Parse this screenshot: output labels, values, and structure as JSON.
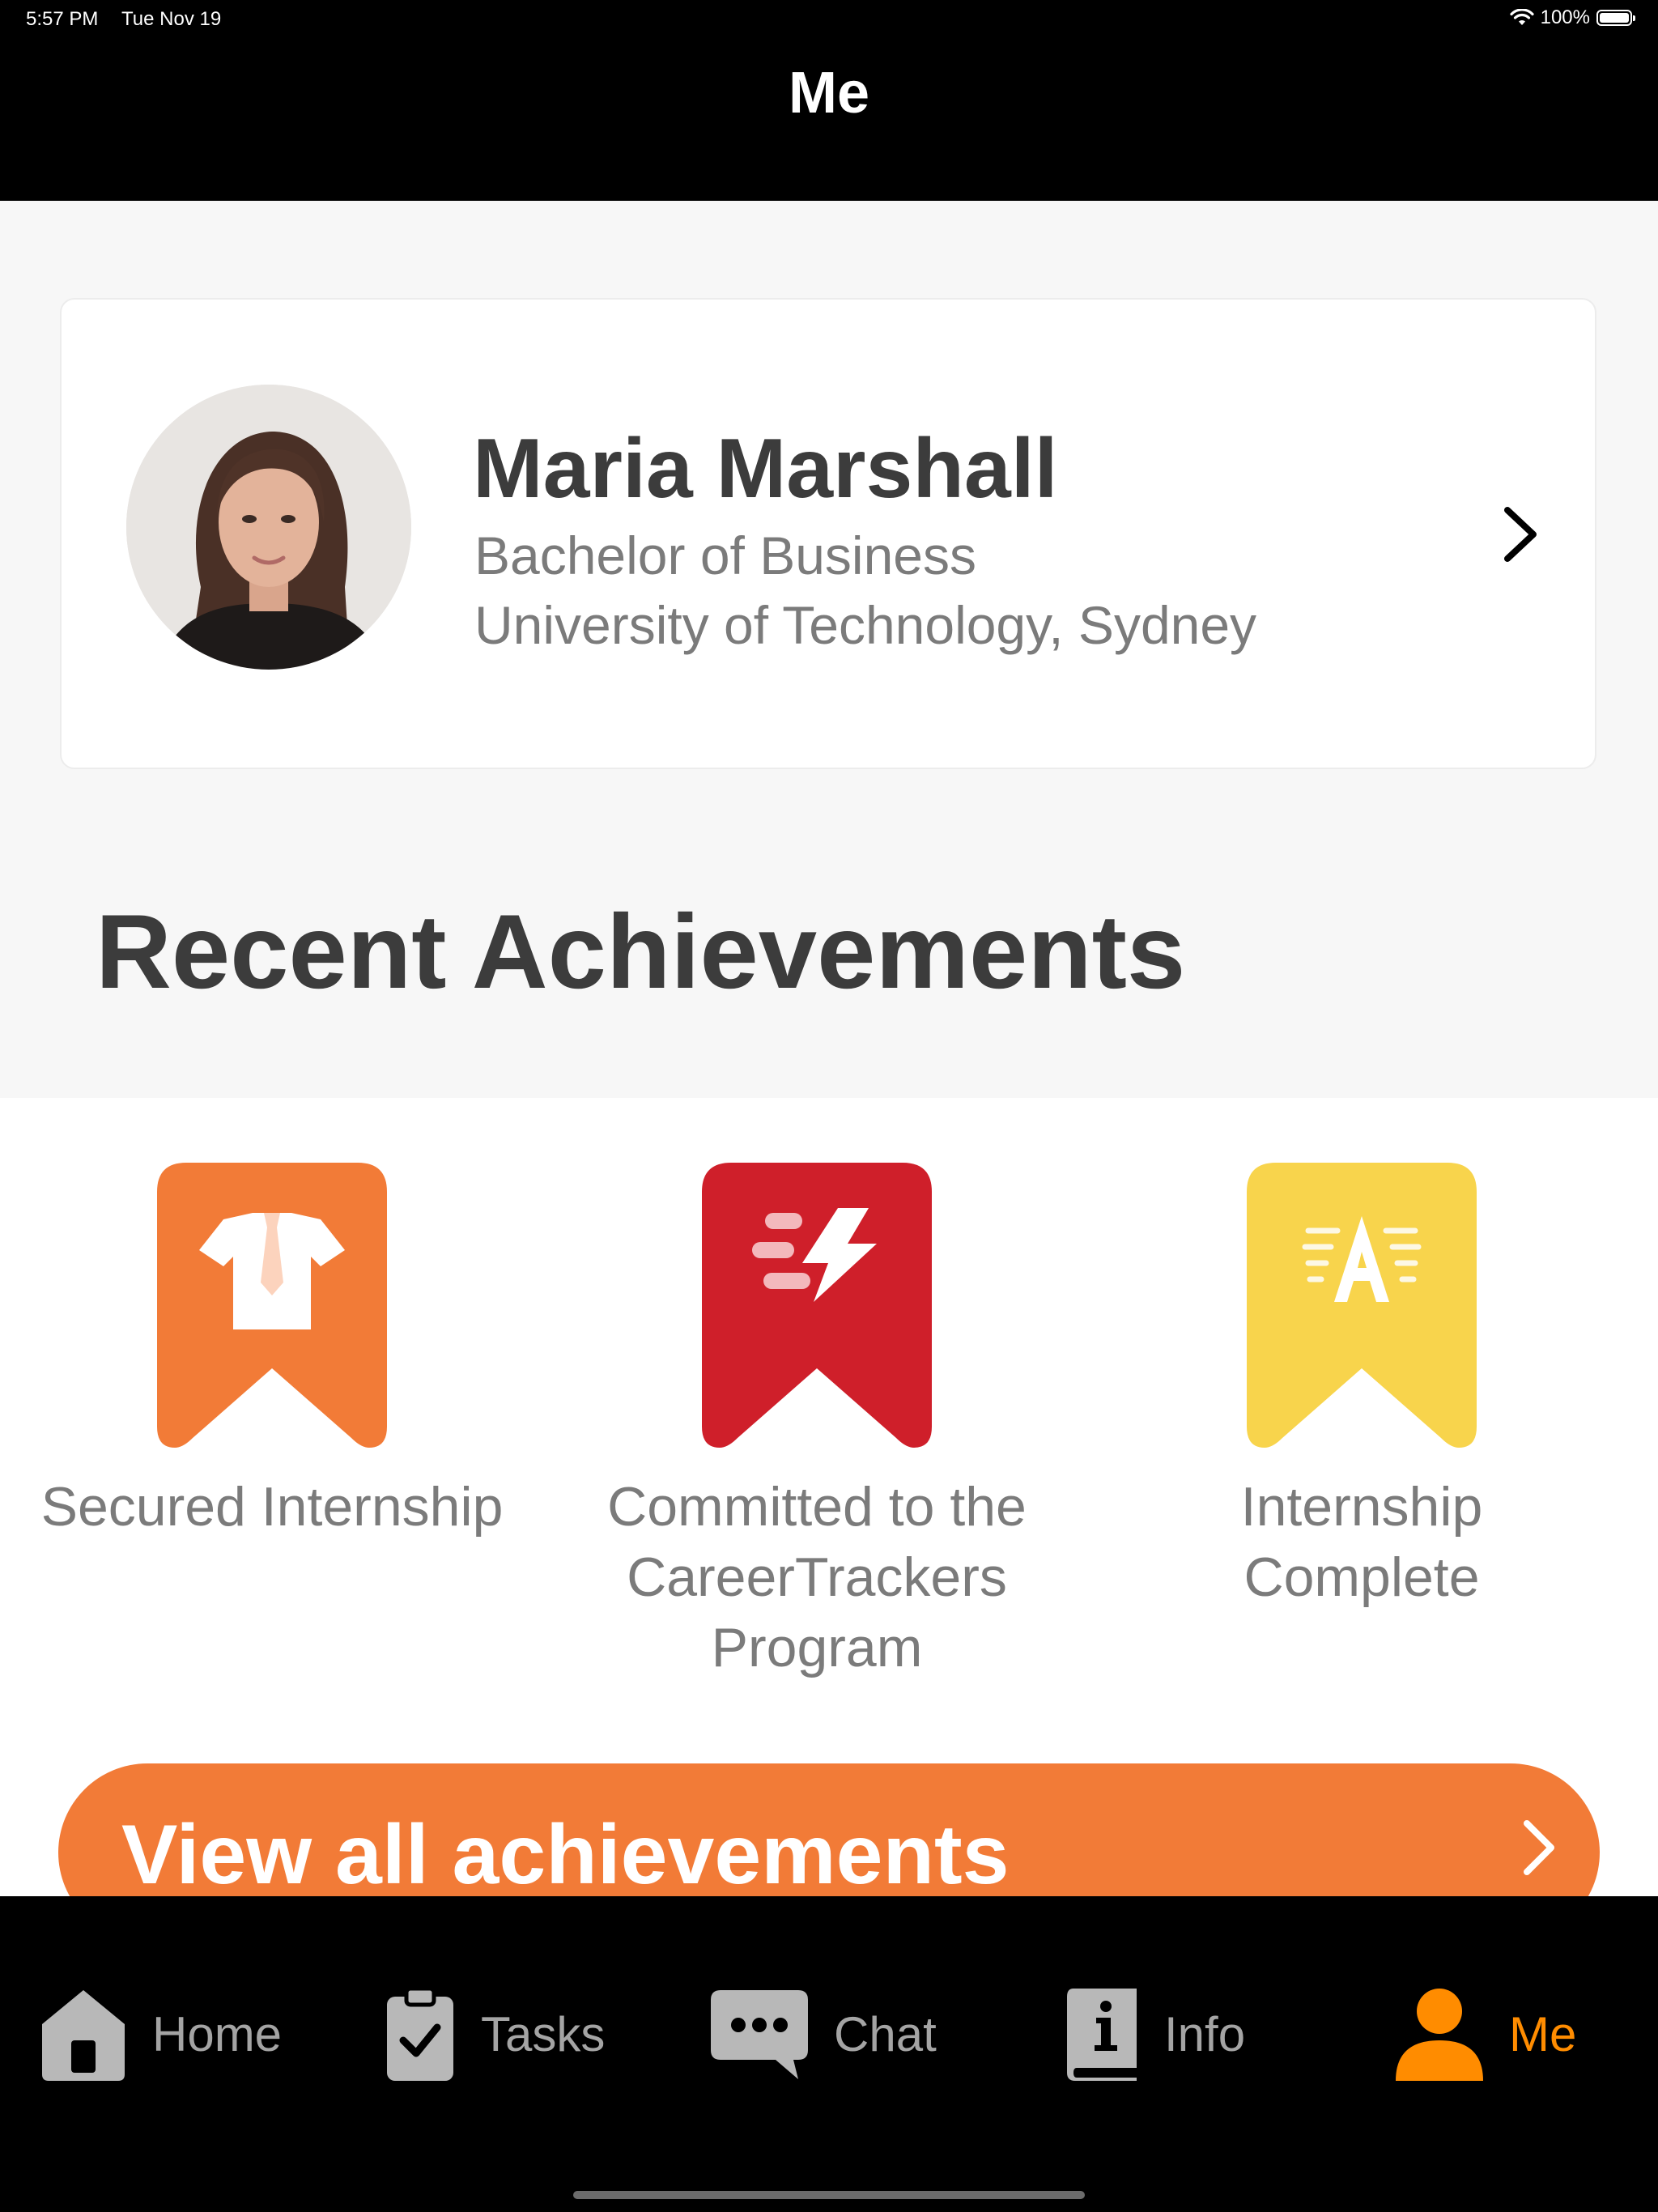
{
  "status_bar": {
    "time": "5:57 PM",
    "date": "Tue Nov 19",
    "battery": "100%"
  },
  "header": {
    "title": "Me"
  },
  "profile": {
    "name": "Maria Marshall",
    "degree": "Bachelor of Business",
    "university": "University of Technology, Sydney"
  },
  "achievements": {
    "title": "Recent Achievements",
    "items": [
      {
        "label": "Secured Internship",
        "color": "#f27b37",
        "icon": "shirt-tie-icon"
      },
      {
        "label": "Committed to the CareerTrackers Program",
        "color": "#cf1f2a",
        "icon": "lightning-icon"
      },
      {
        "label": "Internship Complete",
        "color": "#f8d44c",
        "icon": "letter-a-icon"
      }
    ],
    "view_all_label": "View all achievements"
  },
  "tabbar": {
    "tabs": [
      {
        "label": "Home",
        "icon": "home-icon",
        "active": false
      },
      {
        "label": "Tasks",
        "icon": "clipboard-icon",
        "active": false
      },
      {
        "label": "Chat",
        "icon": "chat-bubble-icon",
        "active": false
      },
      {
        "label": "Info",
        "icon": "info-book-icon",
        "active": false
      },
      {
        "label": "Me",
        "icon": "person-icon",
        "active": true
      }
    ]
  },
  "colors": {
    "accent": "#f27b37",
    "active_tab": "#ff8c00",
    "header_bg": "#000000"
  }
}
